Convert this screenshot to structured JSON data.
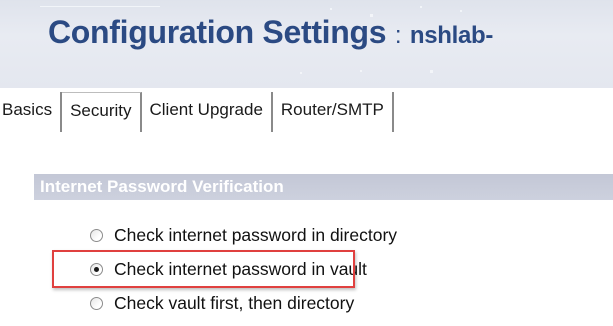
{
  "header": {
    "title": "Configuration Settings",
    "separator": ":",
    "server": "nshlab-"
  },
  "tabs": [
    {
      "label": "Basics"
    },
    {
      "label": "Security",
      "active": true
    },
    {
      "label": "Client Upgrade"
    },
    {
      "label": "Router/SMTP"
    }
  ],
  "section": {
    "title": "Internet Password Verification"
  },
  "options": [
    {
      "label": "Check internet password in directory",
      "selected": false
    },
    {
      "label": "Check internet password in vault",
      "selected": true
    },
    {
      "label": "Check vault first, then directory",
      "selected": false
    }
  ],
  "colors": {
    "title": "#2b4a83",
    "section_bg": "#c3c7d6",
    "highlight": "#e0403f"
  }
}
